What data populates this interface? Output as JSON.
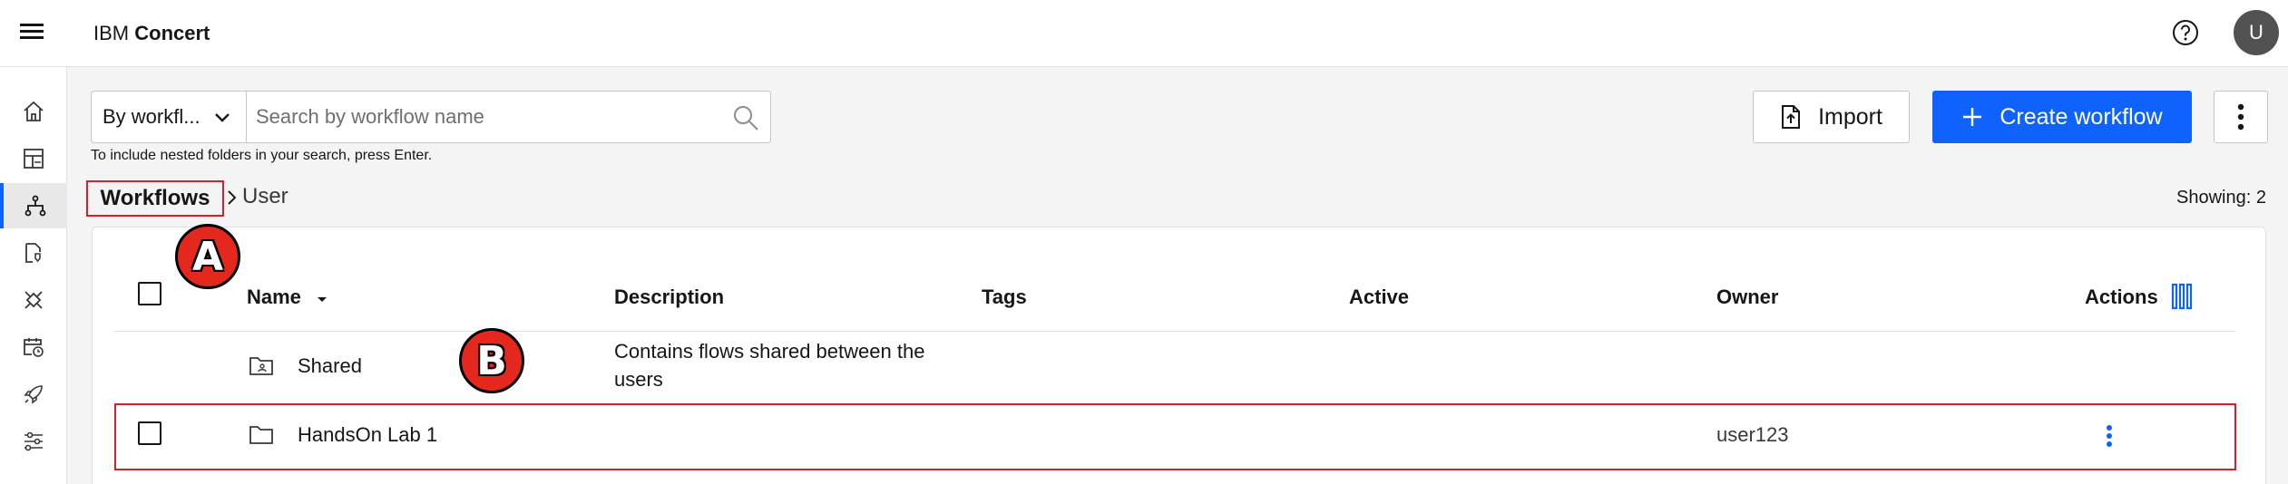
{
  "header": {
    "brand": "IBM",
    "product": "Concert",
    "avatar_initial": "U"
  },
  "rail": {
    "items": [
      "home-icon",
      "dashboard-icon",
      "workflows-icon",
      "document-shield-icon",
      "integrations-icon",
      "calendar-clock-icon",
      "rocket-icon",
      "settings-adjust-icon"
    ],
    "active_index": 2
  },
  "filter": {
    "selected": "By workfl..."
  },
  "search": {
    "placeholder": "Search by workflow name",
    "hint": "To include nested folders in your search, press Enter."
  },
  "toolbar": {
    "import_label": "Import",
    "create_label": "Create workflow"
  },
  "breadcrumb": {
    "root": "Workflows",
    "current": "User"
  },
  "showing": "Showing: 2",
  "table": {
    "columns": {
      "name": "Name",
      "description": "Description",
      "tags": "Tags",
      "active": "Active",
      "owner": "Owner",
      "actions": "Actions"
    },
    "rows": [
      {
        "name": "Shared",
        "description_line1": "Contains flows shared between the",
        "description_line2": "users",
        "owner": ""
      },
      {
        "name": "HandsOn Lab 1",
        "description": "",
        "owner": "user123"
      }
    ]
  },
  "callouts": {
    "a": "A",
    "b": "B"
  },
  "colors": {
    "primary": "#0f62fe",
    "highlight": "#da1e28",
    "callout": "#e5281e"
  }
}
